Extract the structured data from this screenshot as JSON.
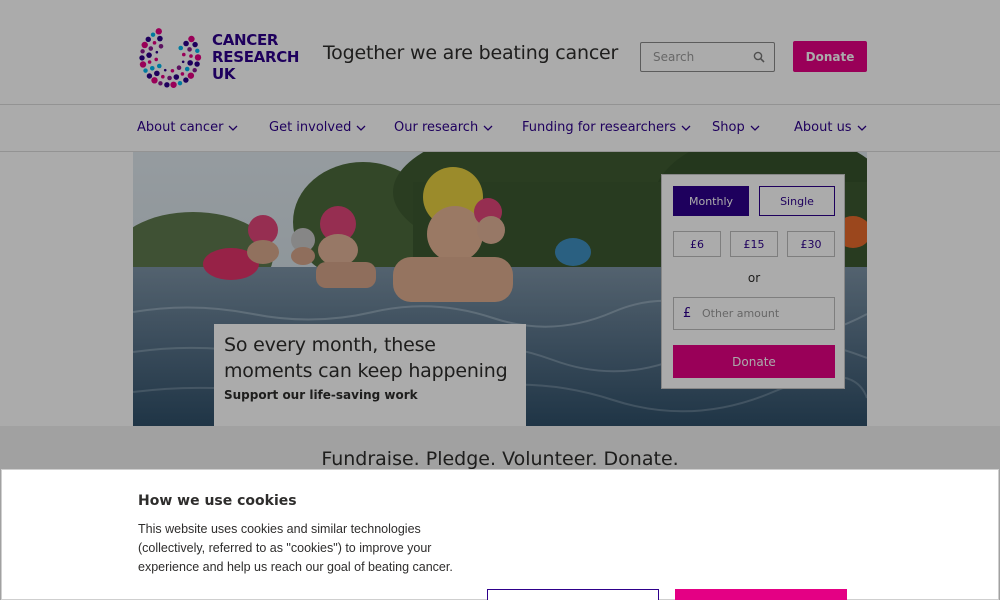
{
  "header": {
    "logo_lines": [
      "CANCER",
      "RESEARCH",
      "UK"
    ],
    "tagline": "Together we are beating cancer",
    "search_placeholder": "Search",
    "donate_label": "Donate"
  },
  "nav": {
    "items": [
      {
        "label": "About cancer"
      },
      {
        "label": "Get involved"
      },
      {
        "label": "Our research"
      },
      {
        "label": "Funding for researchers"
      },
      {
        "label": "Shop"
      },
      {
        "label": "About us"
      }
    ]
  },
  "hero": {
    "caption_title": "So every month, these moments can keep happening",
    "caption_subtitle": "Support our life-saving work"
  },
  "donate_form": {
    "monthly_label": "Monthly",
    "single_label": "Single",
    "amounts": [
      "£6",
      "£15",
      "£30"
    ],
    "or_label": "or",
    "currency_symbol": "£",
    "other_placeholder": "Other amount",
    "donate_label": "Donate"
  },
  "banner": {
    "title": "Fundraise. Pledge. Volunteer. Donate."
  },
  "cookies": {
    "title": "How we use cookies",
    "body": "This website uses cookies and similar technologies (collectively, referred to as \"cookies\") to improve your experience and help us reach our goal of beating cancer."
  },
  "colors": {
    "brand_blue": "#2e008b",
    "brand_pink": "#e40084"
  }
}
